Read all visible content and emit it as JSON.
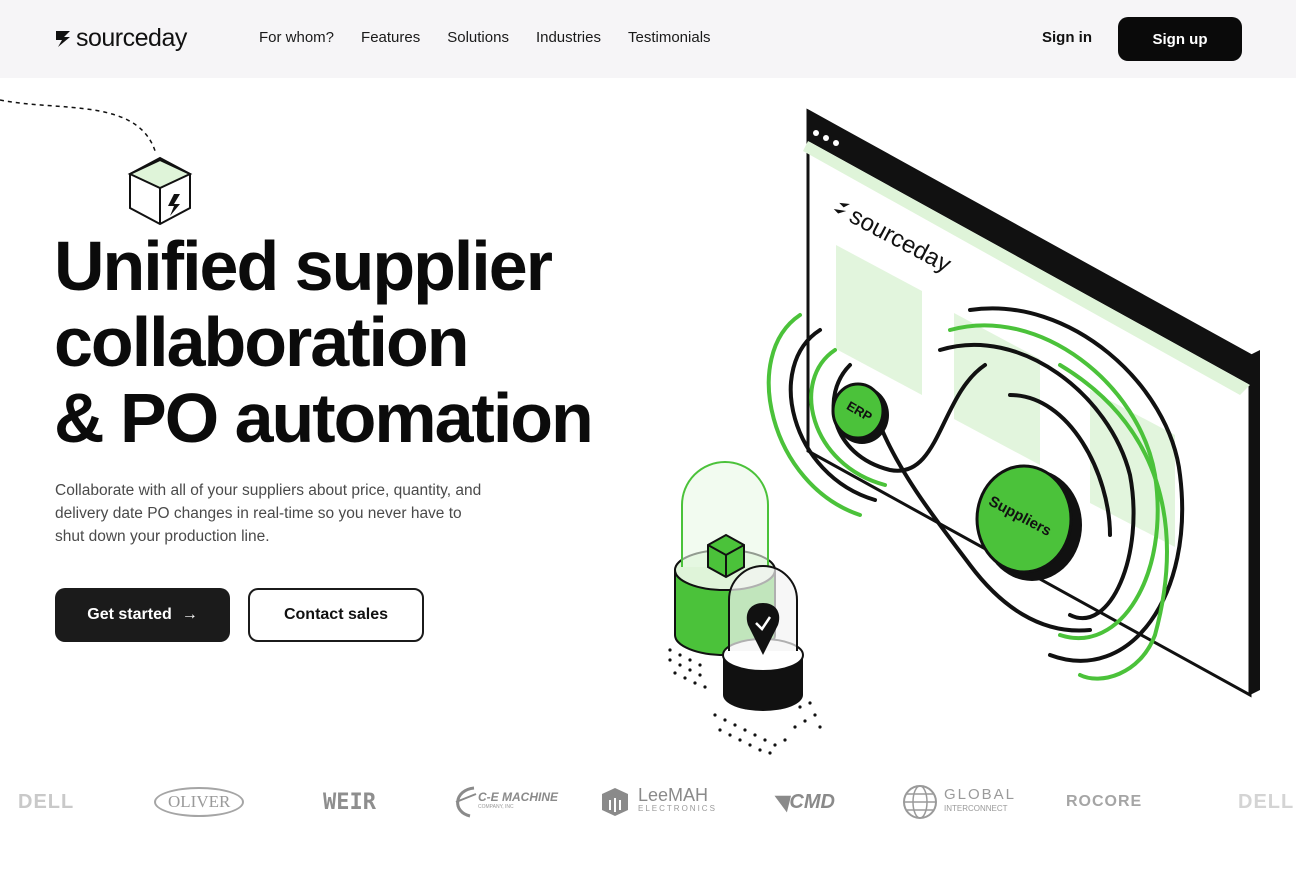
{
  "brand": {
    "name": "sourceday"
  },
  "nav": {
    "items": [
      "For whom?",
      "Features",
      "Solutions",
      "Industries",
      "Testimonials"
    ],
    "signin": "Sign in",
    "signup": "Sign up"
  },
  "hero": {
    "title_lines": [
      "Unified supplier",
      "collaboration",
      "& PO automation"
    ],
    "subtitle": "Collaborate with all of your suppliers about price, quantity, and delivery date PO changes in real-time so you never have to shut down your production line.",
    "cta_primary": "Get started",
    "cta_secondary": "Contact sales"
  },
  "illustration": {
    "screen_brand": "sourceday",
    "erp_label": "ERP",
    "suppliers_label": "Suppliers",
    "accent": "#4bc23a",
    "accent_light": "#dff4d9"
  },
  "customer_logos": [
    {
      "name": "DELL"
    },
    {
      "name": "OLIVER"
    },
    {
      "name": "WEIR"
    },
    {
      "name": "C-E MACHINE",
      "sub": "COMPANY, INC"
    },
    {
      "name": "LeeMAH",
      "sub": "ELECTRONICS"
    },
    {
      "name": "CMD"
    },
    {
      "name": "GLOBAL",
      "sub": "INTERCONNECT"
    },
    {
      "name": "ROCORE"
    },
    {
      "name": "DELL"
    }
  ],
  "colors": {
    "dark": "#0a0a0a",
    "header_bg": "#f6f5f7",
    "green": "#4bc23a"
  }
}
